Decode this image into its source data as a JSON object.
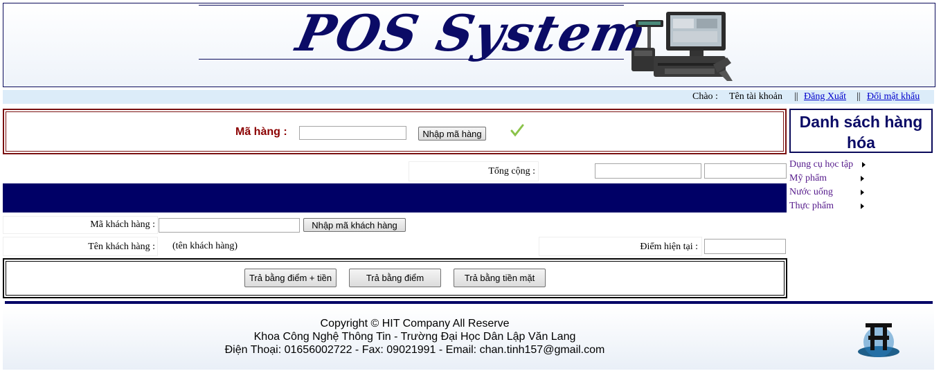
{
  "banner": {
    "logo_text": "POS System"
  },
  "topbar": {
    "greeting": "Chào :",
    "account_name": "Tên tài khoản",
    "separator": "||",
    "logout": "Đăng Xuất",
    "change_password": "Đổi mật khẩu"
  },
  "product_entry": {
    "label": "Mã hàng :",
    "input_value": "",
    "button": "Nhập mã hàng",
    "check_icon": "check-icon",
    "check_color": "#8bc34a"
  },
  "totals": {
    "label": "Tổng cộng :",
    "value1": "",
    "value2": ""
  },
  "sidebar": {
    "title": "Danh sách hàng hóa",
    "items": [
      {
        "label": "Dụng cụ học tập"
      },
      {
        "label": "Mỹ phẩm"
      },
      {
        "label": "Nước uống"
      },
      {
        "label": "Thực phẩm"
      }
    ]
  },
  "customer": {
    "code_label": "Mã khách hàng :",
    "code_value": "",
    "code_button": "Nhập mã khách hàng",
    "name_label": "Tên khách hàng :",
    "name_value": "(tên khách hàng)",
    "points_label": "Điểm hiện tại :",
    "points_value": ""
  },
  "payment": {
    "points_cash": "Trả bằng điểm + tiền",
    "points": "Trả bằng điểm",
    "cash": "Trả bằng tiền mặt"
  },
  "footer": {
    "line1": "Copyright © HIT Company All Reserve",
    "line2": "Khoa Công Nghệ Thông Tin - Trường Đại Học Dân Lập Văn Lang",
    "line3": "Điện Thoại: 01656002722 - Fax: 09021991 - Email: chan.tinh157@gmail.com"
  },
  "colors": {
    "navy": "#000066",
    "maroon": "#8b0000",
    "link": "#0000cc",
    "visited": "#551a8b"
  }
}
